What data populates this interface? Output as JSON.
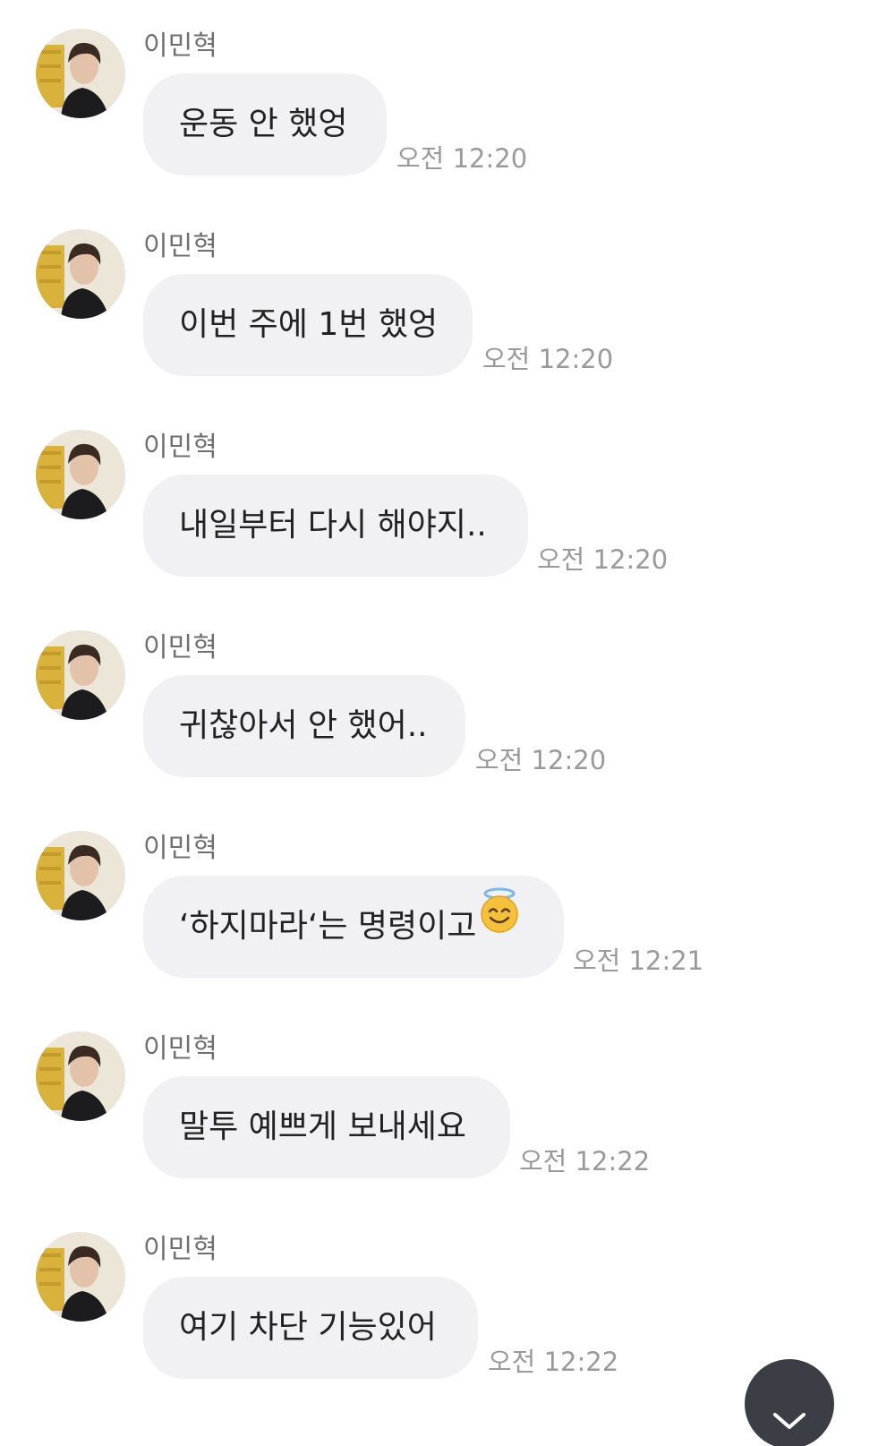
{
  "messages": [
    {
      "sender": "이민혁",
      "text": "운동 안 했엉",
      "time": "오전 12:20"
    },
    {
      "sender": "이민혁",
      "text": "이번 주에 1번 했엉",
      "time": "오전 12:20"
    },
    {
      "sender": "이민혁",
      "text": "내일부터 다시 해야지..",
      "time": "오전 12:20"
    },
    {
      "sender": "이민혁",
      "text": "귀찮아서 안 했어..",
      "time": "오전 12:20"
    },
    {
      "sender": "이민혁",
      "text": "‘하지마라‘는 명령이고",
      "time": "오전 12:21",
      "emoji": "smiling-face-with-halo-icon"
    },
    {
      "sender": "이민혁",
      "text": "말투 예쁘게 보내세요",
      "time": "오전 12:22"
    },
    {
      "sender": "이민혁",
      "text": "여기 차단 기능있어",
      "time": "오전 12:22"
    }
  ],
  "scroll_button": {
    "icon": "chevron-down-icon"
  },
  "colors": {
    "bubble": "#f1f1f3",
    "time": "#9a9a9a",
    "sender": "#6f6f6f",
    "text": "#222222"
  }
}
